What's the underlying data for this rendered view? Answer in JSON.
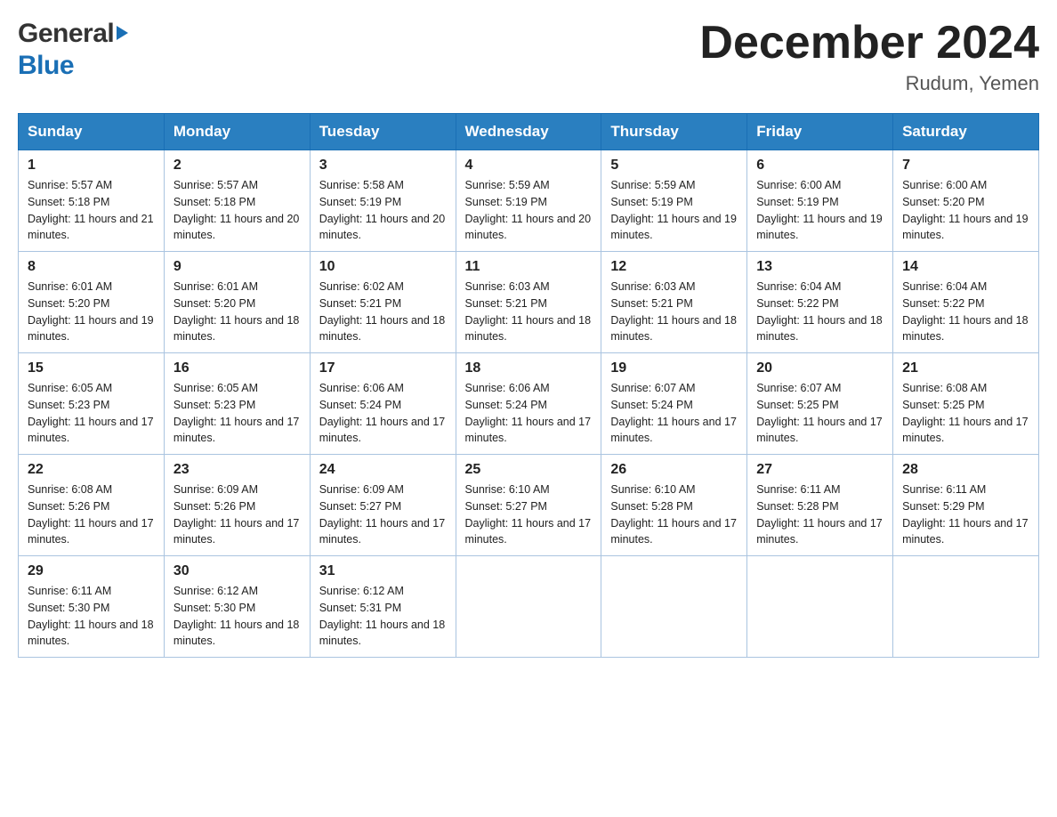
{
  "header": {
    "logo_general": "General",
    "logo_blue": "Blue",
    "month_title": "December 2024",
    "location": "Rudum, Yemen"
  },
  "weekdays": [
    "Sunday",
    "Monday",
    "Tuesday",
    "Wednesday",
    "Thursday",
    "Friday",
    "Saturday"
  ],
  "weeks": [
    [
      {
        "day": "1",
        "sunrise": "5:57 AM",
        "sunset": "5:18 PM",
        "daylight": "11 hours and 21 minutes."
      },
      {
        "day": "2",
        "sunrise": "5:57 AM",
        "sunset": "5:18 PM",
        "daylight": "11 hours and 20 minutes."
      },
      {
        "day": "3",
        "sunrise": "5:58 AM",
        "sunset": "5:19 PM",
        "daylight": "11 hours and 20 minutes."
      },
      {
        "day": "4",
        "sunrise": "5:59 AM",
        "sunset": "5:19 PM",
        "daylight": "11 hours and 20 minutes."
      },
      {
        "day": "5",
        "sunrise": "5:59 AM",
        "sunset": "5:19 PM",
        "daylight": "11 hours and 19 minutes."
      },
      {
        "day": "6",
        "sunrise": "6:00 AM",
        "sunset": "5:19 PM",
        "daylight": "11 hours and 19 minutes."
      },
      {
        "day": "7",
        "sunrise": "6:00 AM",
        "sunset": "5:20 PM",
        "daylight": "11 hours and 19 minutes."
      }
    ],
    [
      {
        "day": "8",
        "sunrise": "6:01 AM",
        "sunset": "5:20 PM",
        "daylight": "11 hours and 19 minutes."
      },
      {
        "day": "9",
        "sunrise": "6:01 AM",
        "sunset": "5:20 PM",
        "daylight": "11 hours and 18 minutes."
      },
      {
        "day": "10",
        "sunrise": "6:02 AM",
        "sunset": "5:21 PM",
        "daylight": "11 hours and 18 minutes."
      },
      {
        "day": "11",
        "sunrise": "6:03 AM",
        "sunset": "5:21 PM",
        "daylight": "11 hours and 18 minutes."
      },
      {
        "day": "12",
        "sunrise": "6:03 AM",
        "sunset": "5:21 PM",
        "daylight": "11 hours and 18 minutes."
      },
      {
        "day": "13",
        "sunrise": "6:04 AM",
        "sunset": "5:22 PM",
        "daylight": "11 hours and 18 minutes."
      },
      {
        "day": "14",
        "sunrise": "6:04 AM",
        "sunset": "5:22 PM",
        "daylight": "11 hours and 18 minutes."
      }
    ],
    [
      {
        "day": "15",
        "sunrise": "6:05 AM",
        "sunset": "5:23 PM",
        "daylight": "11 hours and 17 minutes."
      },
      {
        "day": "16",
        "sunrise": "6:05 AM",
        "sunset": "5:23 PM",
        "daylight": "11 hours and 17 minutes."
      },
      {
        "day": "17",
        "sunrise": "6:06 AM",
        "sunset": "5:24 PM",
        "daylight": "11 hours and 17 minutes."
      },
      {
        "day": "18",
        "sunrise": "6:06 AM",
        "sunset": "5:24 PM",
        "daylight": "11 hours and 17 minutes."
      },
      {
        "day": "19",
        "sunrise": "6:07 AM",
        "sunset": "5:24 PM",
        "daylight": "11 hours and 17 minutes."
      },
      {
        "day": "20",
        "sunrise": "6:07 AM",
        "sunset": "5:25 PM",
        "daylight": "11 hours and 17 minutes."
      },
      {
        "day": "21",
        "sunrise": "6:08 AM",
        "sunset": "5:25 PM",
        "daylight": "11 hours and 17 minutes."
      }
    ],
    [
      {
        "day": "22",
        "sunrise": "6:08 AM",
        "sunset": "5:26 PM",
        "daylight": "11 hours and 17 minutes."
      },
      {
        "day": "23",
        "sunrise": "6:09 AM",
        "sunset": "5:26 PM",
        "daylight": "11 hours and 17 minutes."
      },
      {
        "day": "24",
        "sunrise": "6:09 AM",
        "sunset": "5:27 PM",
        "daylight": "11 hours and 17 minutes."
      },
      {
        "day": "25",
        "sunrise": "6:10 AM",
        "sunset": "5:27 PM",
        "daylight": "11 hours and 17 minutes."
      },
      {
        "day": "26",
        "sunrise": "6:10 AM",
        "sunset": "5:28 PM",
        "daylight": "11 hours and 17 minutes."
      },
      {
        "day": "27",
        "sunrise": "6:11 AM",
        "sunset": "5:28 PM",
        "daylight": "11 hours and 17 minutes."
      },
      {
        "day": "28",
        "sunrise": "6:11 AM",
        "sunset": "5:29 PM",
        "daylight": "11 hours and 17 minutes."
      }
    ],
    [
      {
        "day": "29",
        "sunrise": "6:11 AM",
        "sunset": "5:30 PM",
        "daylight": "11 hours and 18 minutes."
      },
      {
        "day": "30",
        "sunrise": "6:12 AM",
        "sunset": "5:30 PM",
        "daylight": "11 hours and 18 minutes."
      },
      {
        "day": "31",
        "sunrise": "6:12 AM",
        "sunset": "5:31 PM",
        "daylight": "11 hours and 18 minutes."
      },
      null,
      null,
      null,
      null
    ]
  ]
}
